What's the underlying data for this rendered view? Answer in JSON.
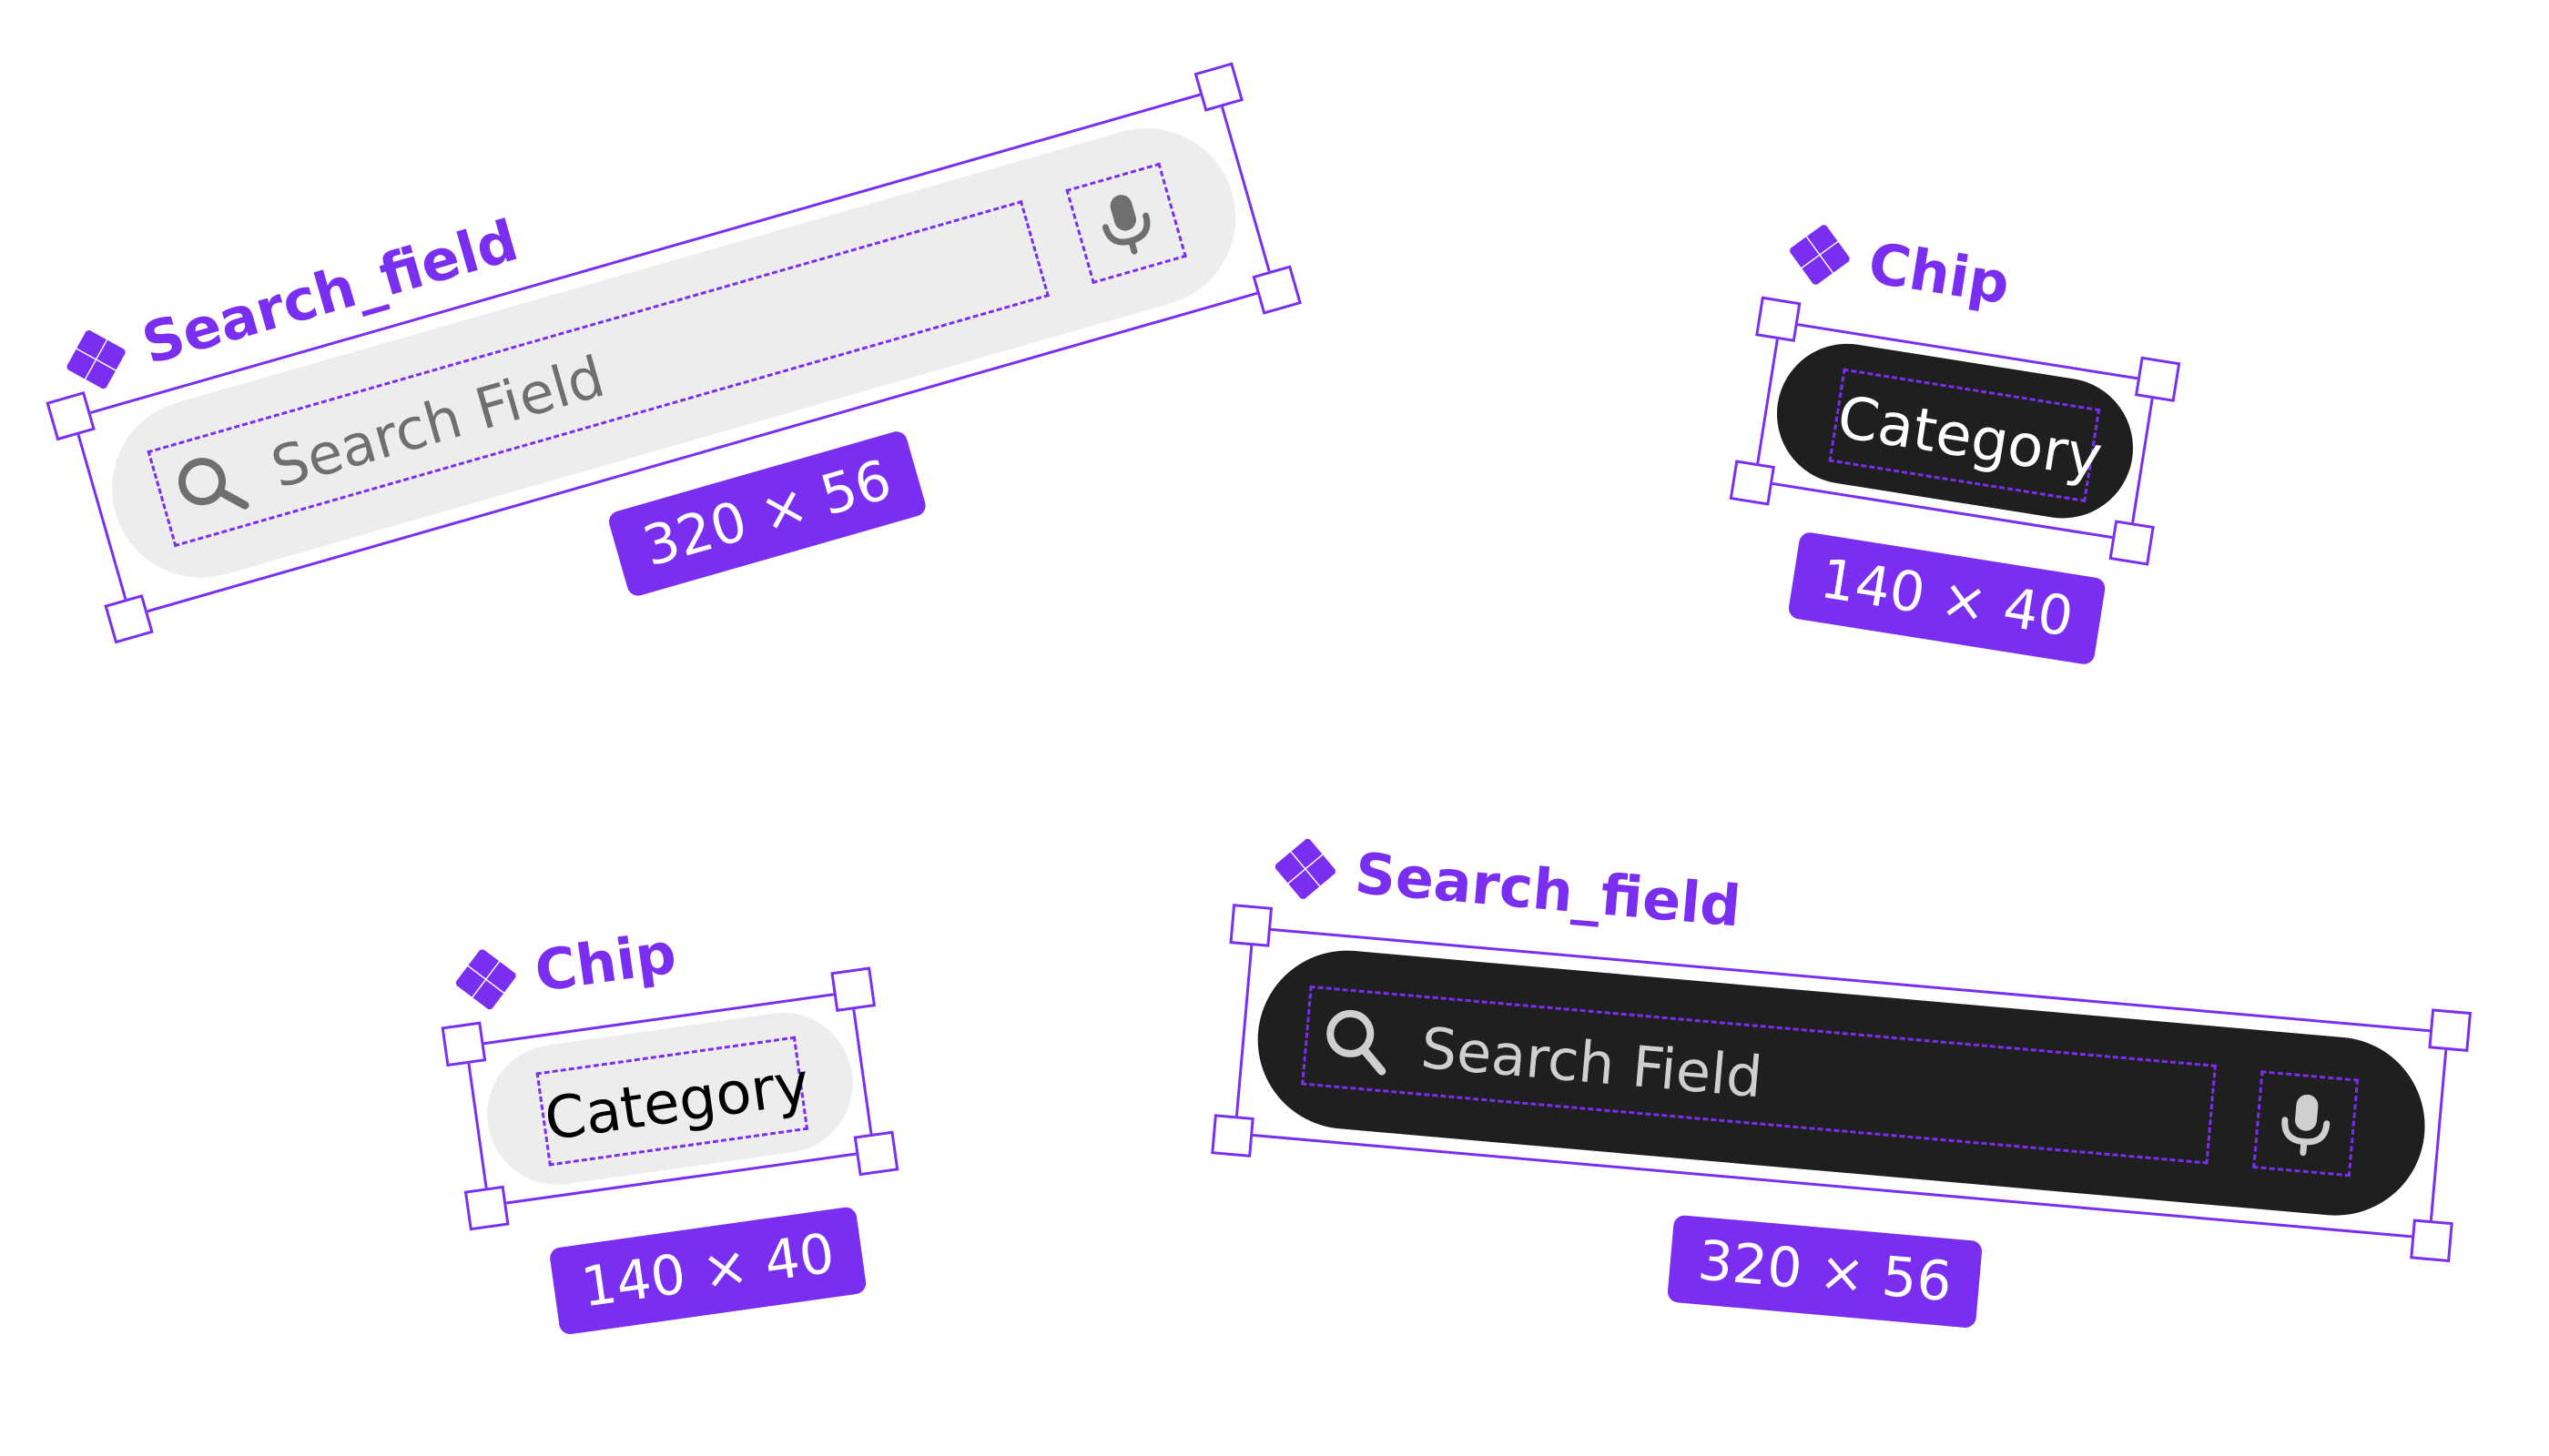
{
  "canvas": {
    "background": "#ffffff",
    "accent": "#7a2ff0"
  },
  "components": [
    {
      "label": "Search_field",
      "icon": "component-icon",
      "theme": "light",
      "fill": "#ededed",
      "text_color": "#6f6f6f",
      "placeholder": "Search Field",
      "leading_icon": "search-icon",
      "trailing_icon": "mic-icon",
      "size": "320 × 56"
    },
    {
      "label": "Chip",
      "icon": "component-icon",
      "theme": "dark",
      "fill": "#1f1f1f",
      "text_color": "#ffffff",
      "text": "Category",
      "size": "140 × 40"
    },
    {
      "label": "Chip",
      "icon": "component-icon",
      "theme": "light",
      "fill": "#ededed",
      "text_color": "#000000",
      "text": "Category",
      "size": "140 × 40"
    },
    {
      "label": "Search_field",
      "icon": "component-icon",
      "theme": "dark",
      "fill": "#1f1f1f",
      "text_color": "#cfcfcf",
      "placeholder": "Search Field",
      "leading_icon": "search-icon",
      "trailing_icon": "mic-icon",
      "size": "320 × 56"
    }
  ]
}
